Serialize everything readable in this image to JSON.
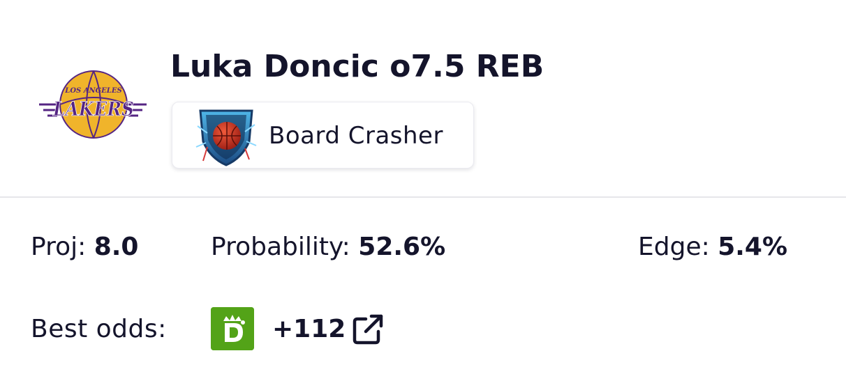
{
  "team": {
    "logo_icon": "lakers-logo-icon",
    "logo_top_text": "LOS ANGELES",
    "logo_main_text": "LAKERS",
    "colors": {
      "purple": "#552583",
      "gold": "#f0b42b"
    }
  },
  "prop": {
    "title": "Luka Doncic o7.5 REB"
  },
  "badge": {
    "icon": "basketball-shield-icon",
    "label": "Board Crasher"
  },
  "stats": {
    "proj_label": "Proj:",
    "proj_value": "8.0",
    "probability_label": "Probability:",
    "probability_value": "52.6%",
    "edge_label": "Edge:",
    "edge_value": "5.4%"
  },
  "odds": {
    "label": "Best odds:",
    "book_icon": "draftkings-logo-icon",
    "book_color": "#53a318",
    "value": "+112",
    "link_icon": "external-link-icon"
  }
}
